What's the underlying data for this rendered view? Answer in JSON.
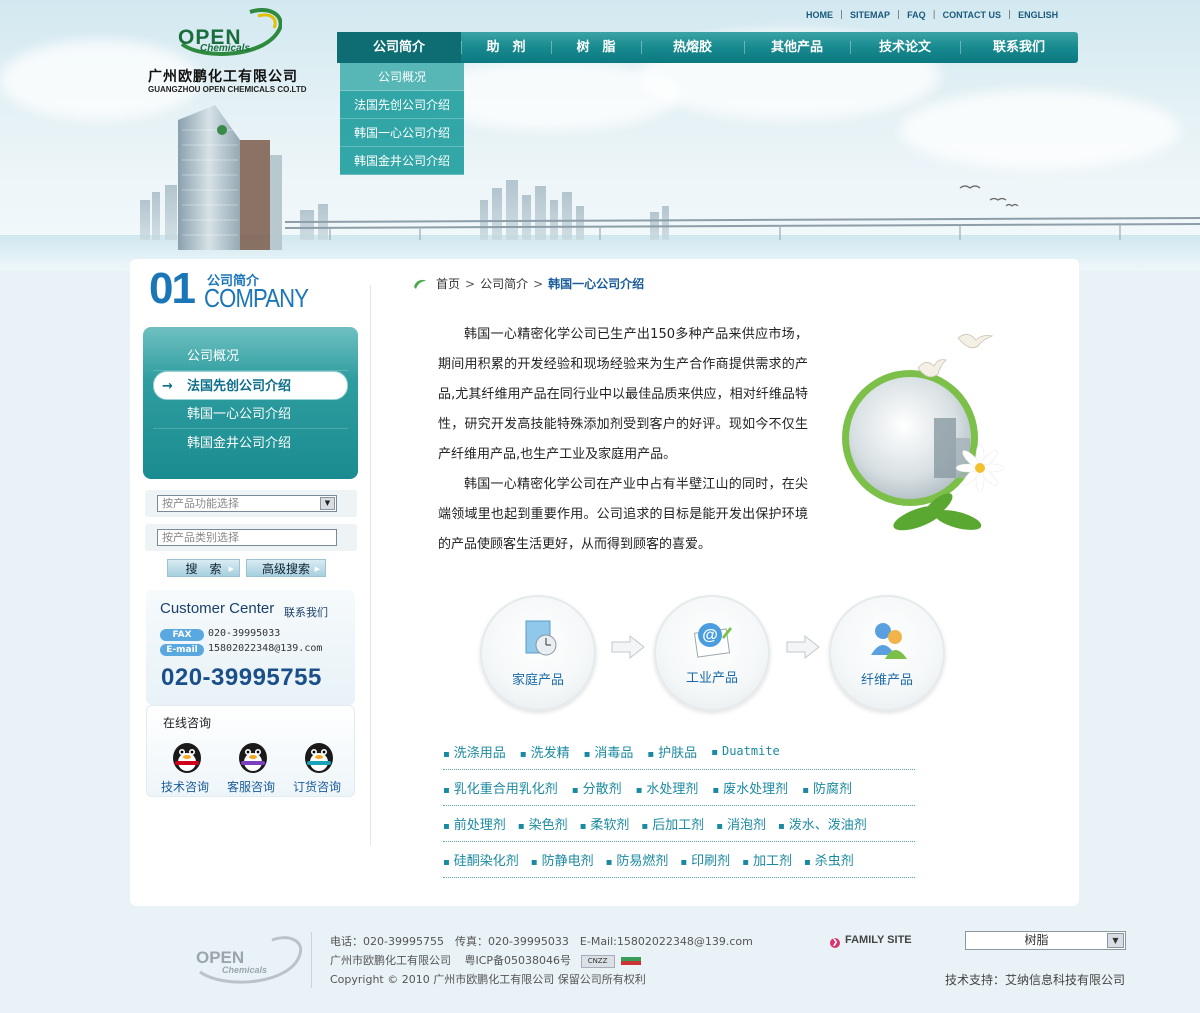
{
  "company": {
    "logo_open": "OPEN",
    "logo_chemicals": "Chemicals",
    "name_cn": "广州欧鹏化工有限公司",
    "name_en": "GUANGZHOU OPEN CHEMICALS CO.LTD"
  },
  "toplinks": [
    "HOME",
    "SITEMAP",
    "FAQ",
    "CONTACT US",
    "ENGLISH"
  ],
  "nav": {
    "items": [
      "公司简介",
      "助　剂",
      "树　脂",
      "热熔胶",
      "其他产品",
      "技术论文",
      "联系我们"
    ],
    "active_index": 0
  },
  "dropdown": [
    "公司概况",
    "法国先创公司介绍",
    "韩国一心公司介绍",
    "韩国金井公司介绍"
  ],
  "section": {
    "number": "01",
    "title_cn": "公司简介",
    "title_en": "COMPANY"
  },
  "sidemenu": {
    "items": [
      "公司概况",
      "法国先创公司介绍",
      "韩国一心公司介绍",
      "韩国金井公司介绍"
    ],
    "active_index": 1,
    "active_arrow": "→"
  },
  "search": {
    "select1_placeholder": "按产品功能选择",
    "select2_placeholder": "按产品类别选择",
    "search_button": "搜　索",
    "advanced_button": "高级搜索"
  },
  "customer_center": {
    "title": "Customer Center",
    "subtitle": "联系我们",
    "fax_label": "FAX",
    "fax": "020-39995033",
    "email_label": "E-mail",
    "email": "15802022348@139.com",
    "phone": "020-39995755"
  },
  "online": {
    "title": "在线咨询",
    "items": [
      "技术咨询",
      "客服咨询",
      "订货咨询"
    ]
  },
  "breadcrumb": {
    "home": "首页",
    "parent": "公司简介",
    "current": "韩国一心公司介绍",
    "separator": ">"
  },
  "article": {
    "p1": "韩国一心精密化学公司已生产出150多种产品来供应市场，期间用积累的开发经验和现场经验来为生产合作商提供需求的产品,尤其纤维用产品在同行业中以最佳品质来供应，相对纤维品特性，研究开发高技能特殊添加剂受到客户的好评。现如今不仅生产纤维用产品,也生产工业及家庭用产品。",
    "p2": "韩国一心精密化学公司在产业中占有半壁江山的同时，在尖端领域里也起到重要作用。公司追求的目标是能开发出保护环境的产品使顾客生活更好，从而得到顾客的喜爱。"
  },
  "categories": [
    "家庭产品",
    "工业产品",
    "纤维产品"
  ],
  "product_links": [
    [
      "洗涤用品",
      "洗发精",
      "消毒品",
      "护肤品",
      "Duatmite"
    ],
    [
      "乳化重合用乳化剂",
      "分散剂",
      "水处理剂",
      "废水处理剂",
      "防腐剂"
    ],
    [
      "前处理剂",
      "染色剂",
      "柔软剂",
      "后加工剂",
      "消泡剂",
      "泼水、泼油剂"
    ],
    [
      "硅酮染化剂",
      "防静电剂",
      "防易燃剂",
      "印刷剂",
      "加工剂",
      "杀虫剂"
    ]
  ],
  "footer": {
    "line1": "电话：020-39995755　传真：020-39995033　E-Mail:15802022348@139.com",
    "line2_company": "广州市欧鹏化工有限公司",
    "line2_icp": "粤ICP备05038046号",
    "icp_badge": "CNZZ",
    "line3": "Copyright © 2010 广州市欧鹏化工有限公司 保留公司所有权利",
    "family_site": "FAMILY SITE",
    "family_select": "树脂",
    "support": "技术支持：艾纳信息科技有限公司",
    "logo_open": "OPEN",
    "logo_chemicals": "Chemicals"
  },
  "colors": {
    "nav_teal": "#178a8f",
    "link_blue": "#1b6aa8",
    "logo_green": "#1a6e3c",
    "side_teal": "#2e9da0"
  }
}
